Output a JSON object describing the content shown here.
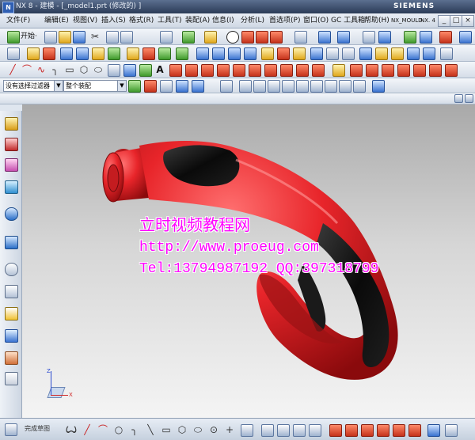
{
  "window": {
    "title": "NX 8 - 建模 - [_model1.prt (修改的) ]",
    "brand": "SIEMENS",
    "logo": "N"
  },
  "menu": {
    "items": [
      "文件(F)",
      "编辑(E)",
      "视图(V)",
      "插入(S)",
      "格式(R)",
      "工具(T)",
      "装配(A)",
      "信息(I)",
      "分析(L)",
      "首选项(P)",
      "窗口(O)",
      "GC 工具箱",
      "帮助(H)",
      "NX_MOULD"
    ],
    "version_label": "NX. 4",
    "window_controls": [
      "_",
      "□",
      "×"
    ]
  },
  "toolbar": {
    "start_label": "开始·",
    "filter_select": "没有选择过滤器",
    "assembly_select": "整个装配"
  },
  "watermark": {
    "line1": "立时视频教程网",
    "line2": "http://www.proeug.com",
    "line3": "Tel:13794987192  QQ:397318799"
  },
  "triad": {
    "x": "X",
    "y": "Y",
    "z": "Z"
  },
  "bottom": {
    "sketch_label": "完成草图"
  },
  "colors": {
    "model_red": "#e8252a",
    "model_black": "#0a0a0a",
    "watermark": "#ff00ff",
    "title_bar": "#2b3b57"
  }
}
